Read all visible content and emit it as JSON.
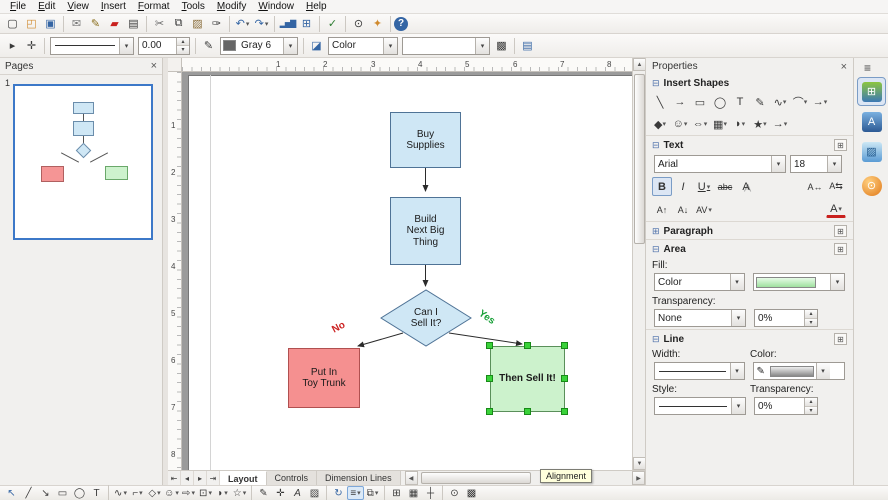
{
  "menu": {
    "items": [
      "File",
      "Edit",
      "View",
      "Insert",
      "Format",
      "Tools",
      "Modify",
      "Window",
      "Help"
    ]
  },
  "tb2": {
    "width": "0.00",
    "line_color": "Gray 6",
    "fill_type": "Color"
  },
  "pages": {
    "title": "Pages",
    "num": "1"
  },
  "ruler": {
    "h": [
      "1",
      "2",
      "3",
      "4",
      "5",
      "6",
      "7",
      "8"
    ],
    "v": [
      "1",
      "2",
      "3",
      "4",
      "5",
      "6",
      "7",
      "8"
    ]
  },
  "flow": {
    "buy": "Buy\nSupplies",
    "build": "Build\nNext Big\nThing",
    "decision": "Can I\nSell It?",
    "no_node": "Put In\nToy Trunk",
    "yes_node": "Then Sell It!",
    "no_label": "No",
    "yes_label": "Yes"
  },
  "tabs": {
    "layout": "Layout",
    "controls": "Controls",
    "dimension": "Dimension Lines"
  },
  "tooltip": "Alignment",
  "props": {
    "title": "Properties",
    "sec_shapes": "Insert Shapes",
    "sec_text": "Text",
    "sec_par": "Paragraph",
    "sec_area": "Area",
    "sec_line": "Line",
    "font": "Arial",
    "size": "18",
    "fill_label": "Fill:",
    "fill_type": "Color",
    "transp_label": "Transparency:",
    "transp_type": "None",
    "transp_val": "0%",
    "width_label": "Width:",
    "color_label": "Color:",
    "style_label": "Style:",
    "line_transp_label": "Transparency:",
    "line_transp_val": "0%"
  },
  "colors": {
    "node_blue": "#cfe7f5",
    "node_red": "#f59090",
    "node_green": "#ccf2cc",
    "handle_green": "#3ad23a",
    "no_label": "#cc2222",
    "yes_label": "#18a038"
  },
  "icons": {
    "dd": "▾",
    "up": "▴",
    "menu": "≡",
    "close": "×",
    "collapse": "⊟",
    "expand": "⊞",
    "launcher": "⊞",
    "new": "▢",
    "open": "◰",
    "save": "▣",
    "email": "✉",
    "edit": "✎",
    "pdf": "▰",
    "print": "▤",
    "cut": "✂",
    "copy": "⧉",
    "paste": "▨",
    "clone": "✑",
    "undo": "↶",
    "redo": "↷",
    "chart": "▂▅▇",
    "table": "⊞",
    "spell": "✓",
    "zoom": "⊙",
    "nav": "✦",
    "help": "?",
    "points": "▸",
    "glue": "✛",
    "pencil": "✎",
    "area": "◪",
    "shadow": "▩",
    "page": "▤",
    "s1": [
      "╲",
      "→",
      "▭",
      "◯",
      "T",
      "✎",
      "∿",
      "⌒",
      "→"
    ],
    "s2": [
      "◆",
      "☺",
      "⇔",
      "▦",
      "◗",
      "★",
      "→"
    ],
    "bold": "B",
    "italic": "I",
    "underline": "U",
    "strike": "abc",
    "shadowa": "A",
    "sp1": "A↔",
    "sp2": "A⇆",
    "grow": "A↑",
    "shrink": "A↓",
    "kern": "AV",
    "fontcolor": "A",
    "b": [
      "↖",
      "╱",
      "↘",
      "▭",
      "◯",
      "T",
      "∿",
      "⌐",
      "◇",
      "☺",
      "⇨",
      "⊡",
      "◗",
      "☆",
      "✎",
      "✛",
      "A",
      "▨",
      "↻",
      "≡",
      "⧉",
      "⊞",
      "▦",
      "┼",
      "⊙",
      "▩"
    ],
    "su": "▲",
    "sd": "▼",
    "sl": "◀",
    "sr": "▶",
    "nav_first": "⇤",
    "nav_prev": "◂",
    "nav_next": "▸",
    "nav_last": "⇥"
  }
}
